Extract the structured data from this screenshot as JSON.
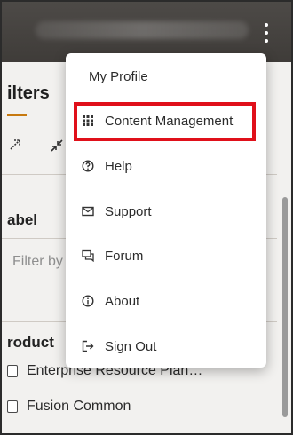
{
  "panel": {
    "title": "ilters",
    "label_heading": "abel",
    "filter_placeholder": "Filter by",
    "product_heading": "roduct",
    "products": [
      {
        "label": "Enterprise Resource Plan…"
      },
      {
        "label": "Fusion Common"
      }
    ]
  },
  "menu": {
    "items": [
      {
        "label": "My Profile",
        "icon": "none"
      },
      {
        "label": "Content Management",
        "icon": "grid-icon"
      },
      {
        "label": "Help",
        "icon": "help-circle-icon"
      },
      {
        "label": "Support",
        "icon": "mail-icon"
      },
      {
        "label": "Forum",
        "icon": "chat-icon"
      },
      {
        "label": "About",
        "icon": "info-circle-icon"
      },
      {
        "label": "Sign Out",
        "icon": "sign-out-icon"
      }
    ]
  },
  "colors": {
    "topbar": "#45423f",
    "highlight": "#e0101a",
    "accent": "#c7790f"
  }
}
